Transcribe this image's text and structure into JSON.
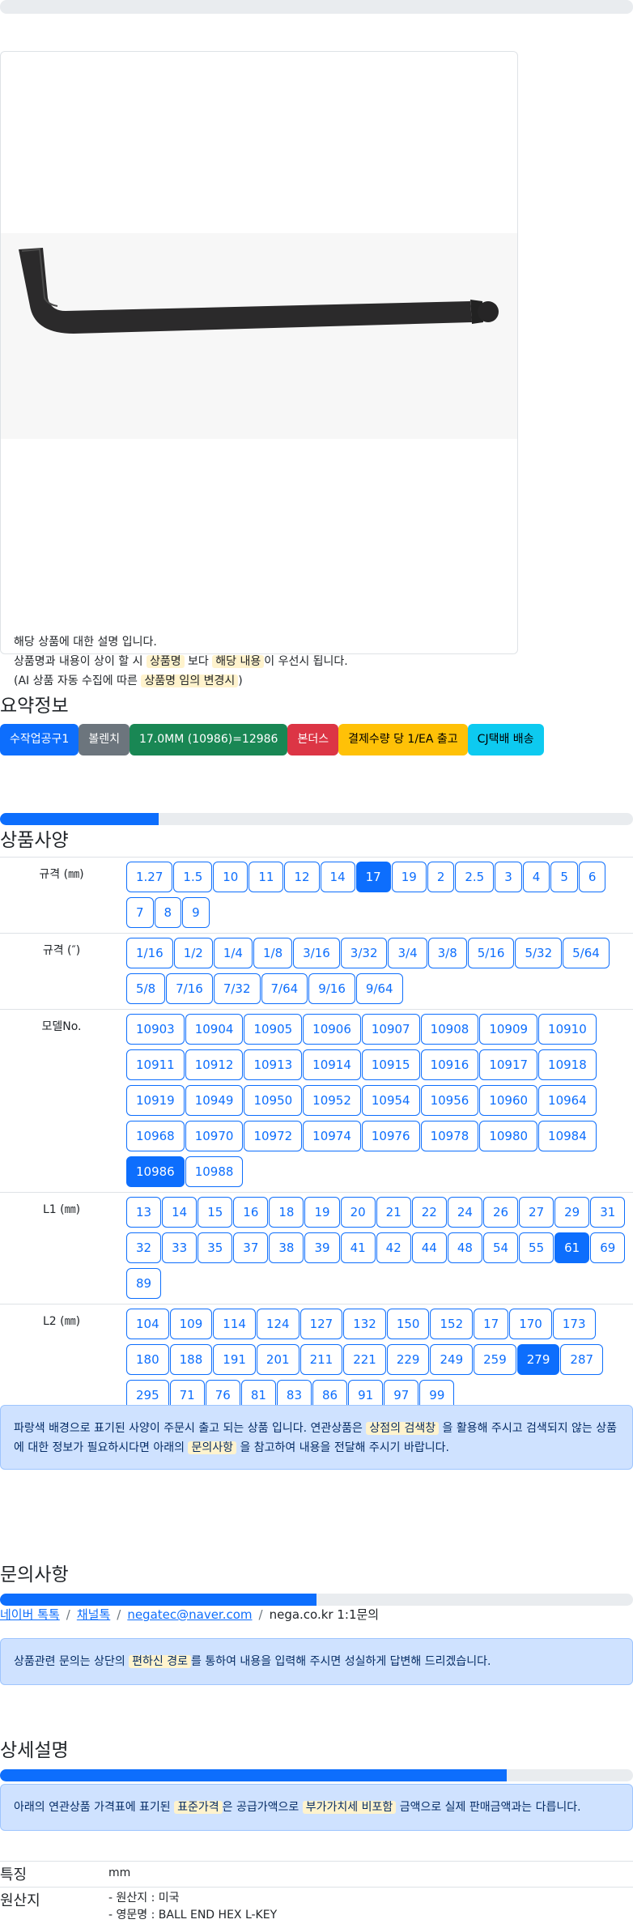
{
  "description": {
    "line1": "해당 상품에 대한 설명 입니다.",
    "line2_a": "상품명과 내용이 상이 할 시",
    "line2_b": "상품명",
    "line2_c": "보다",
    "line2_d": "해당 내용",
    "line2_e": "이 우선시 됩니다.",
    "line3_a": "(AI 상품 자동 수집에 따른",
    "line3_b": "상품명 임의 변경시",
    "line3_c": ")"
  },
  "summary": {
    "title": "요약정보",
    "badges": [
      {
        "label": "수작업공구1",
        "color": "#0d6efd"
      },
      {
        "label": "볼렌치",
        "color": "#6c757d"
      },
      {
        "label": "17.0MM (10986)=12986",
        "color": "#198754"
      },
      {
        "label": "본더스",
        "color": "#dc3545"
      },
      {
        "label": "결제수량 당 1/EA 출고",
        "color": "#ffc107"
      },
      {
        "label": "CJ택배 배송",
        "color": "#0dcaf0"
      }
    ]
  },
  "specs": {
    "title": "상품사양",
    "progress": 0.25,
    "rows": [
      {
        "label": "규격 (㎜)",
        "options": [
          "1.27",
          "1.5",
          "10",
          "11",
          "12",
          "14",
          "17",
          "19",
          "2",
          "2.5",
          "3",
          "4",
          "5",
          "6",
          "7",
          "8",
          "9"
        ],
        "selected": "17"
      },
      {
        "label": "규격 (″)",
        "options": [
          "1/16",
          "1/2",
          "1/4",
          "1/8",
          "3/16",
          "3/32",
          "3/4",
          "3/8",
          "5/16",
          "5/32",
          "5/64",
          "5/8",
          "7/16",
          "7/32",
          "7/64",
          "9/16",
          "9/64"
        ],
        "selected": ""
      },
      {
        "label": "모델No.",
        "options": [
          "10903",
          "10904",
          "10905",
          "10906",
          "10907",
          "10908",
          "10909",
          "10910",
          "10911",
          "10912",
          "10913",
          "10914",
          "10915",
          "10916",
          "10917",
          "10918",
          "10919",
          "10949",
          "10950",
          "10952",
          "10954",
          "10956",
          "10960",
          "10964",
          "10968",
          "10970",
          "10972",
          "10974",
          "10976",
          "10978",
          "10980",
          "10984",
          "10986",
          "10988"
        ],
        "selected": "10986"
      },
      {
        "label": "L1 (㎜)",
        "options": [
          "13",
          "14",
          "15",
          "16",
          "18",
          "19",
          "20",
          "21",
          "22",
          "24",
          "26",
          "27",
          "29",
          "31",
          "32",
          "33",
          "35",
          "37",
          "38",
          "39",
          "41",
          "42",
          "44",
          "48",
          "54",
          "55",
          "61",
          "69",
          "89"
        ],
        "selected": "61"
      },
      {
        "label": "L2 (㎜)",
        "options": [
          "104",
          "109",
          "114",
          "124",
          "127",
          "132",
          "150",
          "152",
          "17",
          "170",
          "173",
          "180",
          "188",
          "191",
          "201",
          "211",
          "221",
          "229",
          "249",
          "259",
          "279",
          "287",
          "295",
          "71",
          "76",
          "81",
          "83",
          "86",
          "91",
          "97",
          "99"
        ],
        "selected": "279"
      }
    ],
    "notice_a": "파랑색 배경으로 표기된 사양이 주문시 출고 되는 상품 입니다. 연관상품은",
    "notice_b": "상점의 검색창",
    "notice_c": "을 활용해 주시고 검색되지 않는 상품에 대한 정보가 필요하시다면 아래의",
    "notice_d": "문의사항",
    "notice_e": "을 참고하여 내용을 전달해 주시기 바랍니다."
  },
  "inquiry": {
    "title": "문의사항",
    "progress": 0.5,
    "links": [
      "네이버 톡톡",
      "채널톡",
      "negatec@naver.com"
    ],
    "plain": "nega.co.kr 1:1문의",
    "notice_a": "상품관련 문의는 상단의",
    "notice_b": "편하신 경로",
    "notice_c": "를 통하여 내용을 입력해 주시면 성실하게 답변해 드리겠습니다."
  },
  "detail": {
    "title": "상세설명",
    "progress": 0.8,
    "notice_a": "아래의 연관상품 가격표에 표기된",
    "notice_b": "표준가격",
    "notice_c": "은 공급가액으로",
    "notice_d": "부가가치세 비포함",
    "notice_e": "금액으로 실제 판매금액과는 다릅니다.",
    "feature_key": "특징",
    "feature_val": "mm",
    "origin_key": "원산지",
    "origin_line1": "- 원산지 : 미국",
    "origin_line2": "- 영문명 : BALL END HEX L-KEY"
  }
}
